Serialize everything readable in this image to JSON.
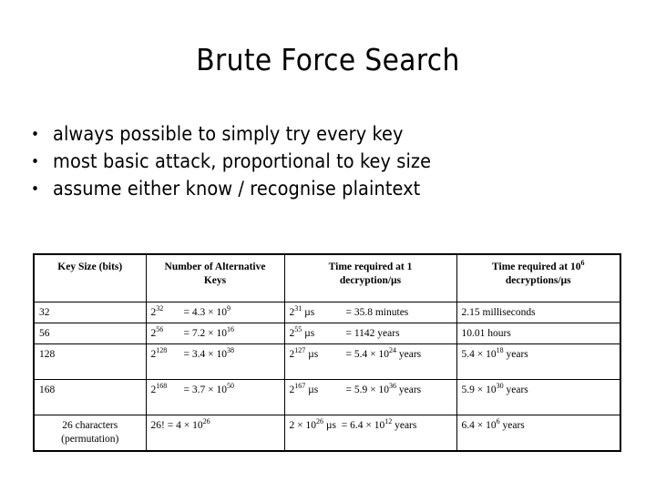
{
  "slide": {
    "title": "Brute Force Search",
    "bullets": [
      {
        "marker": "•",
        "text": "always possible to simply try every key"
      },
      {
        "marker": "•",
        "text": "most basic attack, proportional to key size"
      },
      {
        "marker": "•",
        "text": "assume either know / recognise plaintext"
      }
    ],
    "table": {
      "headers": [
        {
          "line1": "Key Size (bits)",
          "line2": ""
        },
        {
          "line1": "Number of Alternative",
          "line2": "Keys"
        },
        {
          "line1": "Time required at 1",
          "line2": "decryption/µs"
        },
        {
          "line1": "Time required at 10",
          "line1_sup": "6",
          "line2": "decryptions/µs"
        }
      ],
      "rows": [
        {
          "key_size": "32",
          "key_size_align": "left",
          "alt_keys_base": "2",
          "alt_keys_exp": "32",
          "alt_keys_value": "= 4.3 × 10",
          "alt_keys_value_exp": "9",
          "time1_expr_base": "2",
          "time1_expr_exp": "31",
          "time1_expr_unit": " µs",
          "time1_result": "= 35.8 minutes",
          "time1_result_exp": "",
          "time1_result_tail": "",
          "time2": "2.15 milliseconds",
          "time2_exp": "",
          "time2_tail": ""
        },
        {
          "key_size": "56",
          "key_size_align": "left",
          "alt_keys_base": "2",
          "alt_keys_exp": "56",
          "alt_keys_value": "= 7.2 × 10",
          "alt_keys_value_exp": "16",
          "time1_expr_base": "2",
          "time1_expr_exp": "55",
          "time1_expr_unit": " µs",
          "time1_result": "= 1142 years",
          "time1_result_exp": "",
          "time1_result_tail": "",
          "time2": "10.01 hours",
          "time2_exp": "",
          "time2_tail": ""
        },
        {
          "key_size": "128",
          "key_size_align": "left",
          "alt_keys_base": "2",
          "alt_keys_exp": "128",
          "alt_keys_value": "= 3.4 × 10",
          "alt_keys_value_exp": "38",
          "time1_expr_base": "2",
          "time1_expr_exp": "127",
          "time1_expr_unit": " µs",
          "time1_result": "= 5.4 × 10",
          "time1_result_exp": "24",
          "time1_result_tail": " years",
          "time2": "5.4 × 10",
          "time2_exp": "18",
          "time2_tail": " years"
        },
        {
          "key_size": "168",
          "key_size_align": "left",
          "alt_keys_base": "2",
          "alt_keys_exp": "168",
          "alt_keys_value": "= 3.7 × 10",
          "alt_keys_value_exp": "50",
          "time1_expr_base": "2",
          "time1_expr_exp": "167",
          "time1_expr_unit": " µs",
          "time1_result": "= 5.9 × 10",
          "time1_result_exp": "36",
          "time1_result_tail": " years",
          "time2": "5.9 × 10",
          "time2_exp": "30",
          "time2_tail": " years"
        },
        {
          "key_size": "26 characters",
          "key_size_line2": "(permutation)",
          "key_size_align": "center",
          "alt_keys_base": "26!",
          "alt_keys_exp": "",
          "alt_keys_value": "= 4 × 10",
          "alt_keys_value_exp": "26",
          "time1_expr_base": "2 × 10",
          "time1_expr_exp": "26",
          "time1_expr_unit": " µs",
          "time1_result": "= 6.4 × 10",
          "time1_result_exp": "12",
          "time1_result_tail": " years",
          "time2": "6.4 × 10",
          "time2_exp": "6",
          "time2_tail": " years"
        }
      ]
    }
  }
}
